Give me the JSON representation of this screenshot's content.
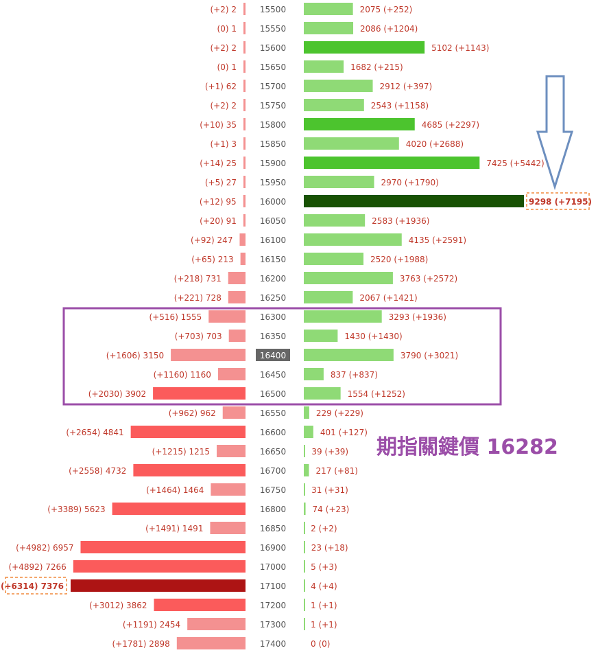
{
  "chart_data": {
    "type": "bar",
    "orientation": "horizontal",
    "categories": [
      "15500",
      "15550",
      "15600",
      "15650",
      "15700",
      "15750",
      "15800",
      "15850",
      "15900",
      "15950",
      "16000",
      "16050",
      "16100",
      "16150",
      "16200",
      "16250",
      "16300",
      "16350",
      "16400",
      "16450",
      "16500",
      "16550",
      "16600",
      "16650",
      "16700",
      "16750",
      "16800",
      "16850",
      "16900",
      "17000",
      "17100",
      "17200",
      "17300",
      "17400"
    ],
    "series": [
      {
        "side": "left",
        "values": [
          2,
          1,
          2,
          1,
          62,
          2,
          35,
          3,
          25,
          27,
          95,
          91,
          247,
          213,
          731,
          728,
          1555,
          703,
          3150,
          1160,
          3902,
          962,
          4841,
          1215,
          4732,
          1464,
          5623,
          1491,
          6957,
          7266,
          7376,
          3862,
          2454,
          2898
        ],
        "changes": [
          2,
          0,
          2,
          0,
          1,
          2,
          10,
          1,
          14,
          5,
          12,
          20,
          92,
          65,
          218,
          221,
          516,
          703,
          1606,
          1160,
          2030,
          962,
          2654,
          1215,
          2558,
          1464,
          3389,
          1491,
          4982,
          4892,
          6314,
          3012,
          1191,
          1781
        ]
      },
      {
        "side": "right",
        "values": [
          2075,
          2086,
          5102,
          1682,
          2912,
          2543,
          4685,
          4020,
          7425,
          2970,
          9298,
          2583,
          4135,
          2520,
          3763,
          2067,
          3293,
          1430,
          3790,
          837,
          1554,
          229,
          401,
          39,
          217,
          31,
          74,
          2,
          23,
          5,
          4,
          1,
          1,
          0
        ],
        "changes": [
          252,
          1204,
          1143,
          215,
          397,
          1158,
          2297,
          2688,
          5442,
          1790,
          7195,
          1936,
          2591,
          1988,
          2572,
          1421,
          1936,
          1430,
          3021,
          837,
          1252,
          229,
          127,
          39,
          81,
          31,
          23,
          2,
          18,
          3,
          4,
          1,
          1,
          0
        ]
      }
    ],
    "highlight_strike": "16400",
    "left_max_index": 30,
    "right_max_index": 10,
    "colors": {
      "left_normal": "#f49191",
      "left_strong": "#fb5b5b",
      "left_max": "#ad1414",
      "right_normal": "#8fda76",
      "right_strong": "#4cc42e",
      "right_max": "#185204",
      "label": "#c0392b",
      "strike_highlight_bg": "#666666",
      "box_color": "#9b4ea8",
      "arrow_color": "#6d8fbf",
      "callout_border": "#f0893c"
    },
    "annotation": "期指關鍵價 16282"
  }
}
